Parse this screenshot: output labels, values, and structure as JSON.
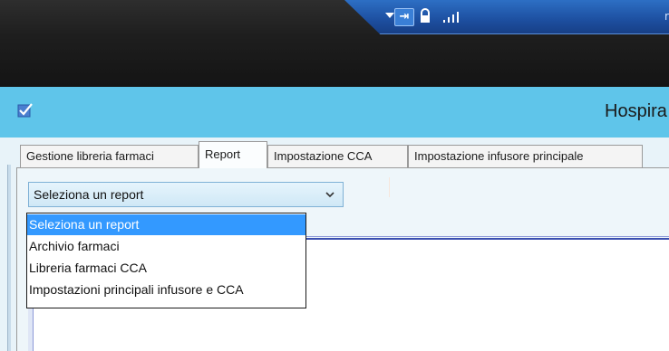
{
  "remote_bar": {
    "icons": [
      "chevron-down-icon",
      "pin-icon",
      "lock-icon",
      "signal-icon"
    ],
    "pin_glyph": "⇥",
    "partial_text": "r"
  },
  "app": {
    "title": "Hospira",
    "accent_color": "#5fc5ea"
  },
  "tabs": [
    {
      "label": "Gestione libreria farmaci",
      "active": false
    },
    {
      "label": "Report",
      "active": true
    },
    {
      "label": "Impostazione CCA",
      "active": false
    },
    {
      "label": "Impostazione infusore principale",
      "active": false
    }
  ],
  "report_select": {
    "value": "Seleziona un report",
    "options": [
      "Seleziona un report",
      "Archivio farmaci",
      "Libreria farmaci CCA",
      "Impostazioni principali infusore e CCA"
    ],
    "selected_index": 0,
    "highlight_color": "#3399ff"
  }
}
